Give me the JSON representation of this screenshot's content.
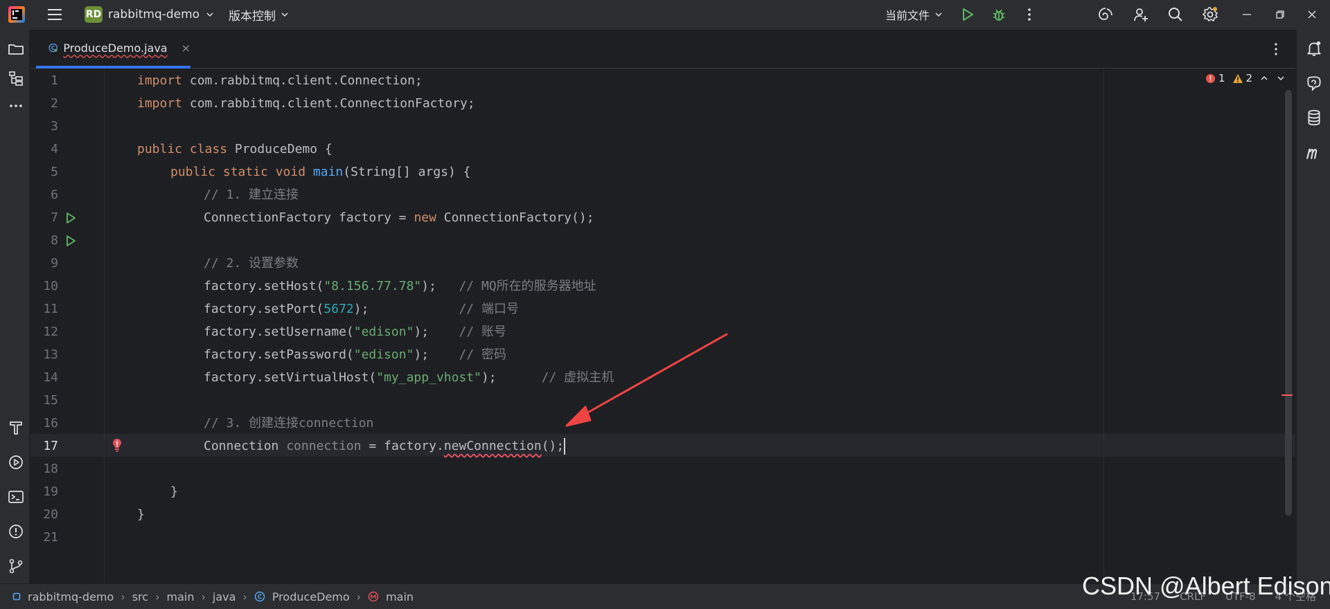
{
  "titlebar": {
    "project_badge": "RD",
    "project_name": "rabbitmq-demo",
    "vcs_label": "版本控制",
    "run_config": "当前文件"
  },
  "tab": {
    "file_name": "ProduceDemo.java",
    "close_glyph": "×"
  },
  "inspections": {
    "errors": "1",
    "warnings": "2"
  },
  "editor": {
    "line_numbers": [
      "1",
      "2",
      "3",
      "4",
      "5",
      "6",
      "7",
      "8",
      "9",
      "10",
      "11",
      "12",
      "13",
      "14",
      "15",
      "16",
      "17",
      "18",
      "19",
      "20",
      "21"
    ],
    "current_line": "17",
    "lines": {
      "l1_kw": "import",
      "l1_rest": " com.rabbitmq.client.Connection;",
      "l2_kw": "import",
      "l2_rest": " com.rabbitmq.client.ConnectionFactory;",
      "l4_kw": "public class",
      "l4_rest": " ProduceDemo {",
      "l5_kw": "public static void",
      "l5_fn": "main",
      "l5_rest": "(String[] args) {",
      "l6_cmt": "// 1. 建立连接",
      "l7_a": "ConnectionFactory factory = ",
      "l7_kw": "new",
      "l7_b": " ConnectionFactory();",
      "l9_cmt": "// 2. 设置参数",
      "l10_a": "factory.setHost(",
      "l10_str": "\"8.156.77.78\"",
      "l10_b": ");   ",
      "l10_cmt": "// MQ所在的服务器地址",
      "l11_a": "factory.setPort(",
      "l11_num": "5672",
      "l11_b": ");            ",
      "l11_cmt": "// 端口号",
      "l12_a": "factory.setUsername(",
      "l12_str": "\"edison\"",
      "l12_b": ");    ",
      "l12_cmt": "// 账号",
      "l13_a": "factory.setPassword(",
      "l13_str": "\"edison\"",
      "l13_b": ");    ",
      "l13_cmt": "// 密码",
      "l14_a": "factory.setVirtualHost(",
      "l14_str": "\"my_app_vhost\"",
      "l14_b": ");      ",
      "l14_cmt": "// 虚拟主机",
      "l16_cmt": "// 3. 创建连接connection",
      "l17_a": "Connection ",
      "l17_var": "connection",
      "l17_b": " = factory.",
      "l17_err": "newConnection",
      "l17_c": "();",
      "l19": "}",
      "l20": "}"
    }
  },
  "statusbar": {
    "crumbs": [
      "rabbitmq-demo",
      "src",
      "main",
      "java",
      "ProduceDemo",
      "main"
    ],
    "separator": "›",
    "position": "17:57",
    "line_sep": "CRLF",
    "encoding": "UTF-8",
    "indent": "4 个空格"
  },
  "watermark": "CSDN @Albert Edison",
  "colors": {
    "keyword": "#cf8e6d",
    "function": "#56a8f5",
    "string": "#6aab73",
    "number": "#2aacb8",
    "comment": "#7a7e85",
    "error": "#f75464",
    "accent": "#3574f0",
    "annotation_arrow": "#ef4444"
  }
}
